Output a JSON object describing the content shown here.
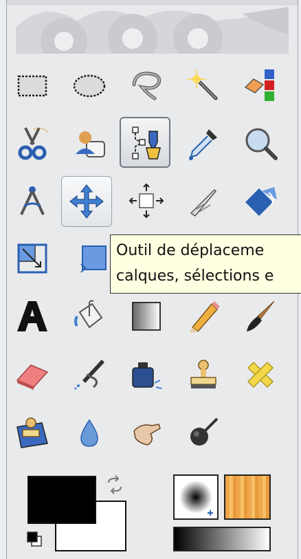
{
  "tooltip": {
    "line1": "Outil de déplaceme",
    "line2": "calques, sélections e"
  },
  "tools": [
    {
      "name": "rect-select-icon"
    },
    {
      "name": "ellipse-select-icon"
    },
    {
      "name": "free-select-icon"
    },
    {
      "name": "fuzzy-select-icon"
    },
    {
      "name": "select-by-color-icon"
    },
    {
      "name": "scissors-select-icon"
    },
    {
      "name": "foreground-select-icon"
    },
    {
      "name": "paths-icon",
      "state": "active"
    },
    {
      "name": "color-picker-icon"
    },
    {
      "name": "zoom-icon"
    },
    {
      "name": "measure-icon"
    },
    {
      "name": "move-icon",
      "state": "hover"
    },
    {
      "name": "alignment-icon"
    },
    {
      "name": "crop-icon"
    },
    {
      "name": "rotate-icon"
    },
    {
      "name": "scale-icon"
    },
    {
      "name": "shear-icon"
    },
    {
      "name": "text-icon"
    },
    {
      "name": "bucket-fill-icon"
    },
    {
      "name": "blend-icon"
    },
    {
      "name": "pencil-icon"
    },
    {
      "name": "paintbrush-icon"
    },
    {
      "name": "eraser-icon"
    },
    {
      "name": "airbrush-icon"
    },
    {
      "name": "ink-icon"
    },
    {
      "name": "clone-icon"
    },
    {
      "name": "heal-icon"
    },
    {
      "name": "perspective-clone-icon"
    },
    {
      "name": "blur-sharpen-icon"
    },
    {
      "name": "smudge-icon"
    },
    {
      "name": "dodge-burn-icon"
    }
  ],
  "colors": {
    "foreground": "#000000",
    "background": "#ffffff",
    "tooltip_bg": "#ffffe1",
    "accent_blue": "#3f7fd0"
  }
}
